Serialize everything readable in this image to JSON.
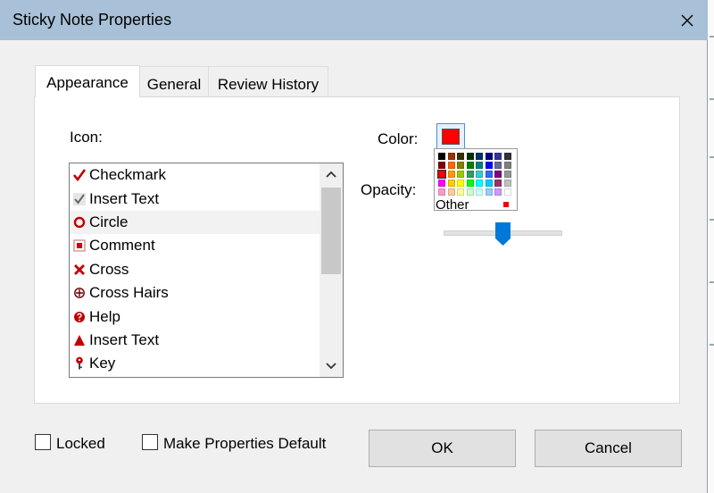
{
  "window": {
    "title": "Sticky Note Properties"
  },
  "tabs": [
    {
      "label": "Appearance",
      "active": true
    },
    {
      "label": "General",
      "active": false
    },
    {
      "label": "Review History",
      "active": false
    }
  ],
  "appearance": {
    "icon_label": "Icon:",
    "icons": [
      {
        "label": "Checkmark",
        "icon": "checkmark-icon"
      },
      {
        "label": "Insert Text",
        "icon": "checkmark-gray-icon"
      },
      {
        "label": "Circle",
        "icon": "circle-icon",
        "selected": true
      },
      {
        "label": "Comment",
        "icon": "comment-icon"
      },
      {
        "label": "Cross",
        "icon": "cross-icon"
      },
      {
        "label": "Cross Hairs",
        "icon": "crosshairs-icon"
      },
      {
        "label": "Help",
        "icon": "help-icon"
      },
      {
        "label": "Insert Text",
        "icon": "triangle-icon"
      },
      {
        "label": "Key",
        "icon": "key-icon"
      }
    ],
    "color_label": "Color:",
    "color_value": "#ff0000",
    "opacity_label": "Opacity:",
    "opacity_fraction": 0.5,
    "palette": {
      "rows": [
        [
          "#000000",
          "#993300",
          "#333300",
          "#003300",
          "#003366",
          "#000080",
          "#333399",
          "#333333"
        ],
        [
          "#800000",
          "#ff6600",
          "#808000",
          "#008000",
          "#008080",
          "#0000ff",
          "#666699",
          "#808080"
        ],
        [
          "#ff0000",
          "#ff9900",
          "#99cc00",
          "#339966",
          "#33cccc",
          "#3366ff",
          "#800080",
          "#969696"
        ],
        [
          "#ff00ff",
          "#ffcc00",
          "#ffff00",
          "#00ff00",
          "#00ffff",
          "#00ccff",
          "#993366",
          "#c0c0c0"
        ],
        [
          "#ff99cc",
          "#ffcc99",
          "#ffff99",
          "#ccffcc",
          "#ccffff",
          "#99ccff",
          "#cc99ff",
          "#ffffff"
        ]
      ],
      "selected": [
        2,
        0
      ],
      "other_label": "Other"
    }
  },
  "footer": {
    "locked_label": "Locked",
    "locked_checked": false,
    "default_label": "Make Properties Default",
    "default_checked": false,
    "ok_label": "OK",
    "cancel_label": "Cancel"
  }
}
